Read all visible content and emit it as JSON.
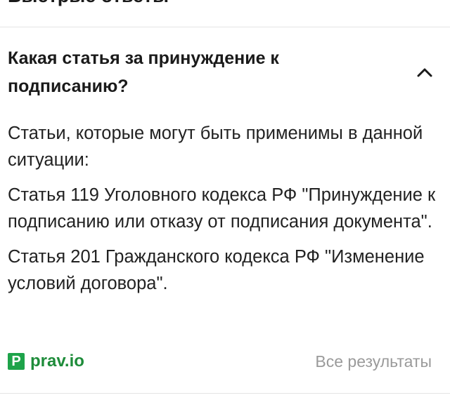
{
  "section": {
    "title": "Быстрые ответы"
  },
  "qa": {
    "question": "Какая статья за принуждение к подписанию?",
    "expanded": true,
    "chevron_icon": "chevron-up-icon",
    "answer_paragraphs": [
      "Статьи, которые могут быть применимы в данной ситуации:",
      "Статья 119 Уголовного кодекса РФ \"Принуждение к подписанию или отказу от подписания документа\".",
      "Статья 201 Гражданского кодекса РФ \"Изменение условий договора\"."
    ],
    "source": {
      "logo_letter": "P",
      "name": "prav.io",
      "logo_color": "#1ea34a"
    },
    "all_results_label": "Все результаты"
  }
}
